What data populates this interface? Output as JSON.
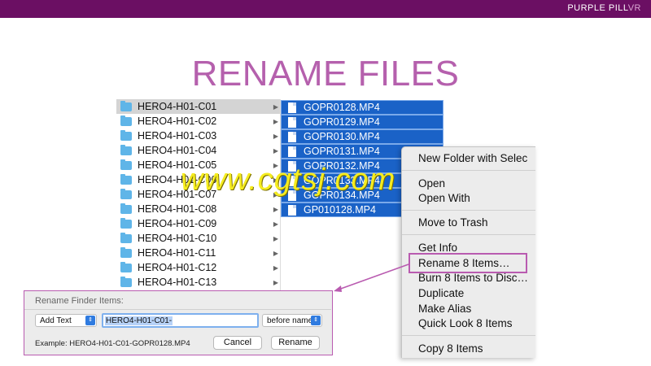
{
  "header": {
    "brand_main": "PURPLE PILL",
    "brand_accent": "VR",
    "bar_color": "#6b0f63"
  },
  "slide": {
    "title": "RENAME FILES",
    "title_color": "#b560ad"
  },
  "finder": {
    "folders": [
      {
        "label": "HERO4-H01-C01",
        "selected": true
      },
      {
        "label": "HERO4-H01-C02"
      },
      {
        "label": "HERO4-H01-C03"
      },
      {
        "label": "HERO4-H01-C04"
      },
      {
        "label": "HERO4-H01-C05"
      },
      {
        "label": "HERO4-H01-C06"
      },
      {
        "label": "HERO4-H01-C07"
      },
      {
        "label": "HERO4-H01-C08"
      },
      {
        "label": "HERO4-H01-C09"
      },
      {
        "label": "HERO4-H01-C10"
      },
      {
        "label": "HERO4-H01-C11"
      },
      {
        "label": "HERO4-H01-C12"
      },
      {
        "label": "HERO4-H01-C13"
      }
    ],
    "files": [
      {
        "label": "GOPR0128.MP4"
      },
      {
        "label": "GOPR0129.MP4"
      },
      {
        "label": "GOPR0130.MP4"
      },
      {
        "label": "GOPR0131.MP4"
      },
      {
        "label": "GOPR0132.MP4"
      },
      {
        "label": "GOPR0133.MP4"
      },
      {
        "label": "GOPR0134.MP4"
      },
      {
        "label": "GP010128.MP4"
      }
    ],
    "selection_color": "#1a62c7"
  },
  "context_menu": {
    "items": [
      {
        "label": "New Folder with Selec"
      },
      {
        "label": "Open"
      },
      {
        "label": "Open With"
      },
      {
        "label": "Move to Trash"
      },
      {
        "label": "Get Info"
      },
      {
        "label": "Rename 8 Items…",
        "highlighted": true
      },
      {
        "label": "Burn 8 Items to Disc…"
      },
      {
        "label": "Duplicate"
      },
      {
        "label": "Make Alias"
      },
      {
        "label": "Quick Look 8 Items"
      },
      {
        "label": "Copy 8 Items"
      }
    ]
  },
  "watermark": {
    "text": "www.cgtsj.com"
  },
  "rename_dialog": {
    "title": "Rename Finder Items:",
    "mode_select": "Add Text",
    "text_value": "HERO4-H01-C01-",
    "position_select": "before name",
    "example": "Example: HERO4-H01-C01-GOPR0128.MP4",
    "cancel_label": "Cancel",
    "rename_label": "Rename",
    "accent_color": "#b95bb0"
  }
}
